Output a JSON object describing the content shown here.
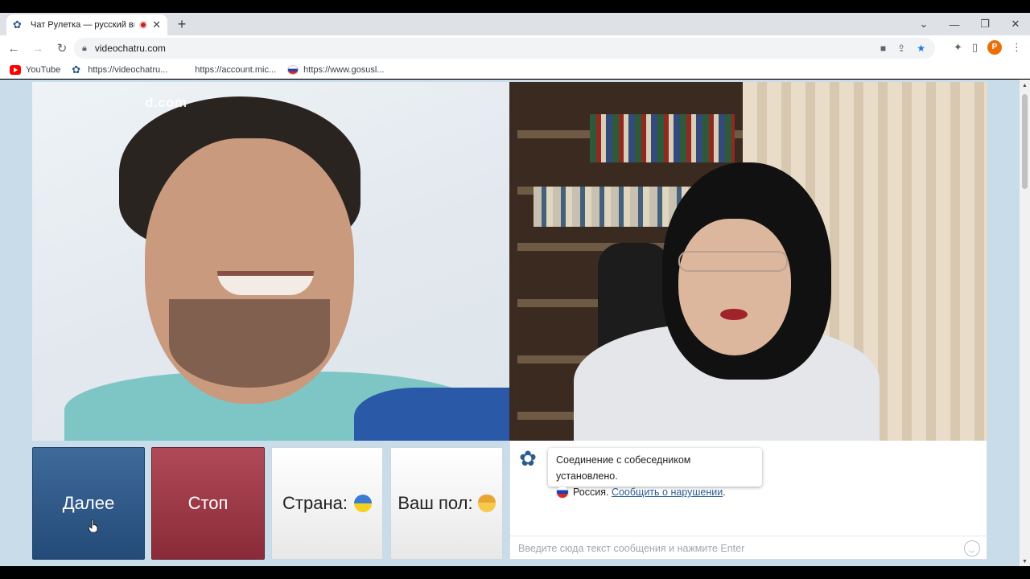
{
  "browser": {
    "tab": {
      "title": "Чат Рулетка — русский видео",
      "favicon": "videochat-flower-icon"
    },
    "window_controls": [
      "chevron-down-icon",
      "minimize-icon",
      "restore-icon",
      "close-icon"
    ],
    "url": "videochatru.com",
    "profile_initial": "P",
    "bookmarks": [
      {
        "label": "YouTube",
        "icon": "youtube-icon"
      },
      {
        "label": "https://videochatru...",
        "icon": "videochat-flower-icon"
      },
      {
        "label": "https://account.mic...",
        "icon": "microsoft-icon"
      },
      {
        "label": "https://www.gosusl...",
        "icon": "russia-flag-icon"
      }
    ]
  },
  "video": {
    "watermark": "d.com"
  },
  "controls": {
    "next_label": "Далее",
    "stop_label": "Стоп",
    "country_label": "Страна:",
    "gender_label": "Ваш пол:"
  },
  "chat": {
    "system_message": "Соединение с собеседником установлено.",
    "country": "Россия.",
    "report_link": "Сообщить о нарушении",
    "report_suffix": ".",
    "input_placeholder": "Введите сюда текст сообщения и нажмите Enter"
  },
  "colors": {
    "next_button": "#2f5a8a",
    "stop_button": "#9e3846",
    "page_background": "#c8dcea",
    "link": "#2a5d96"
  }
}
